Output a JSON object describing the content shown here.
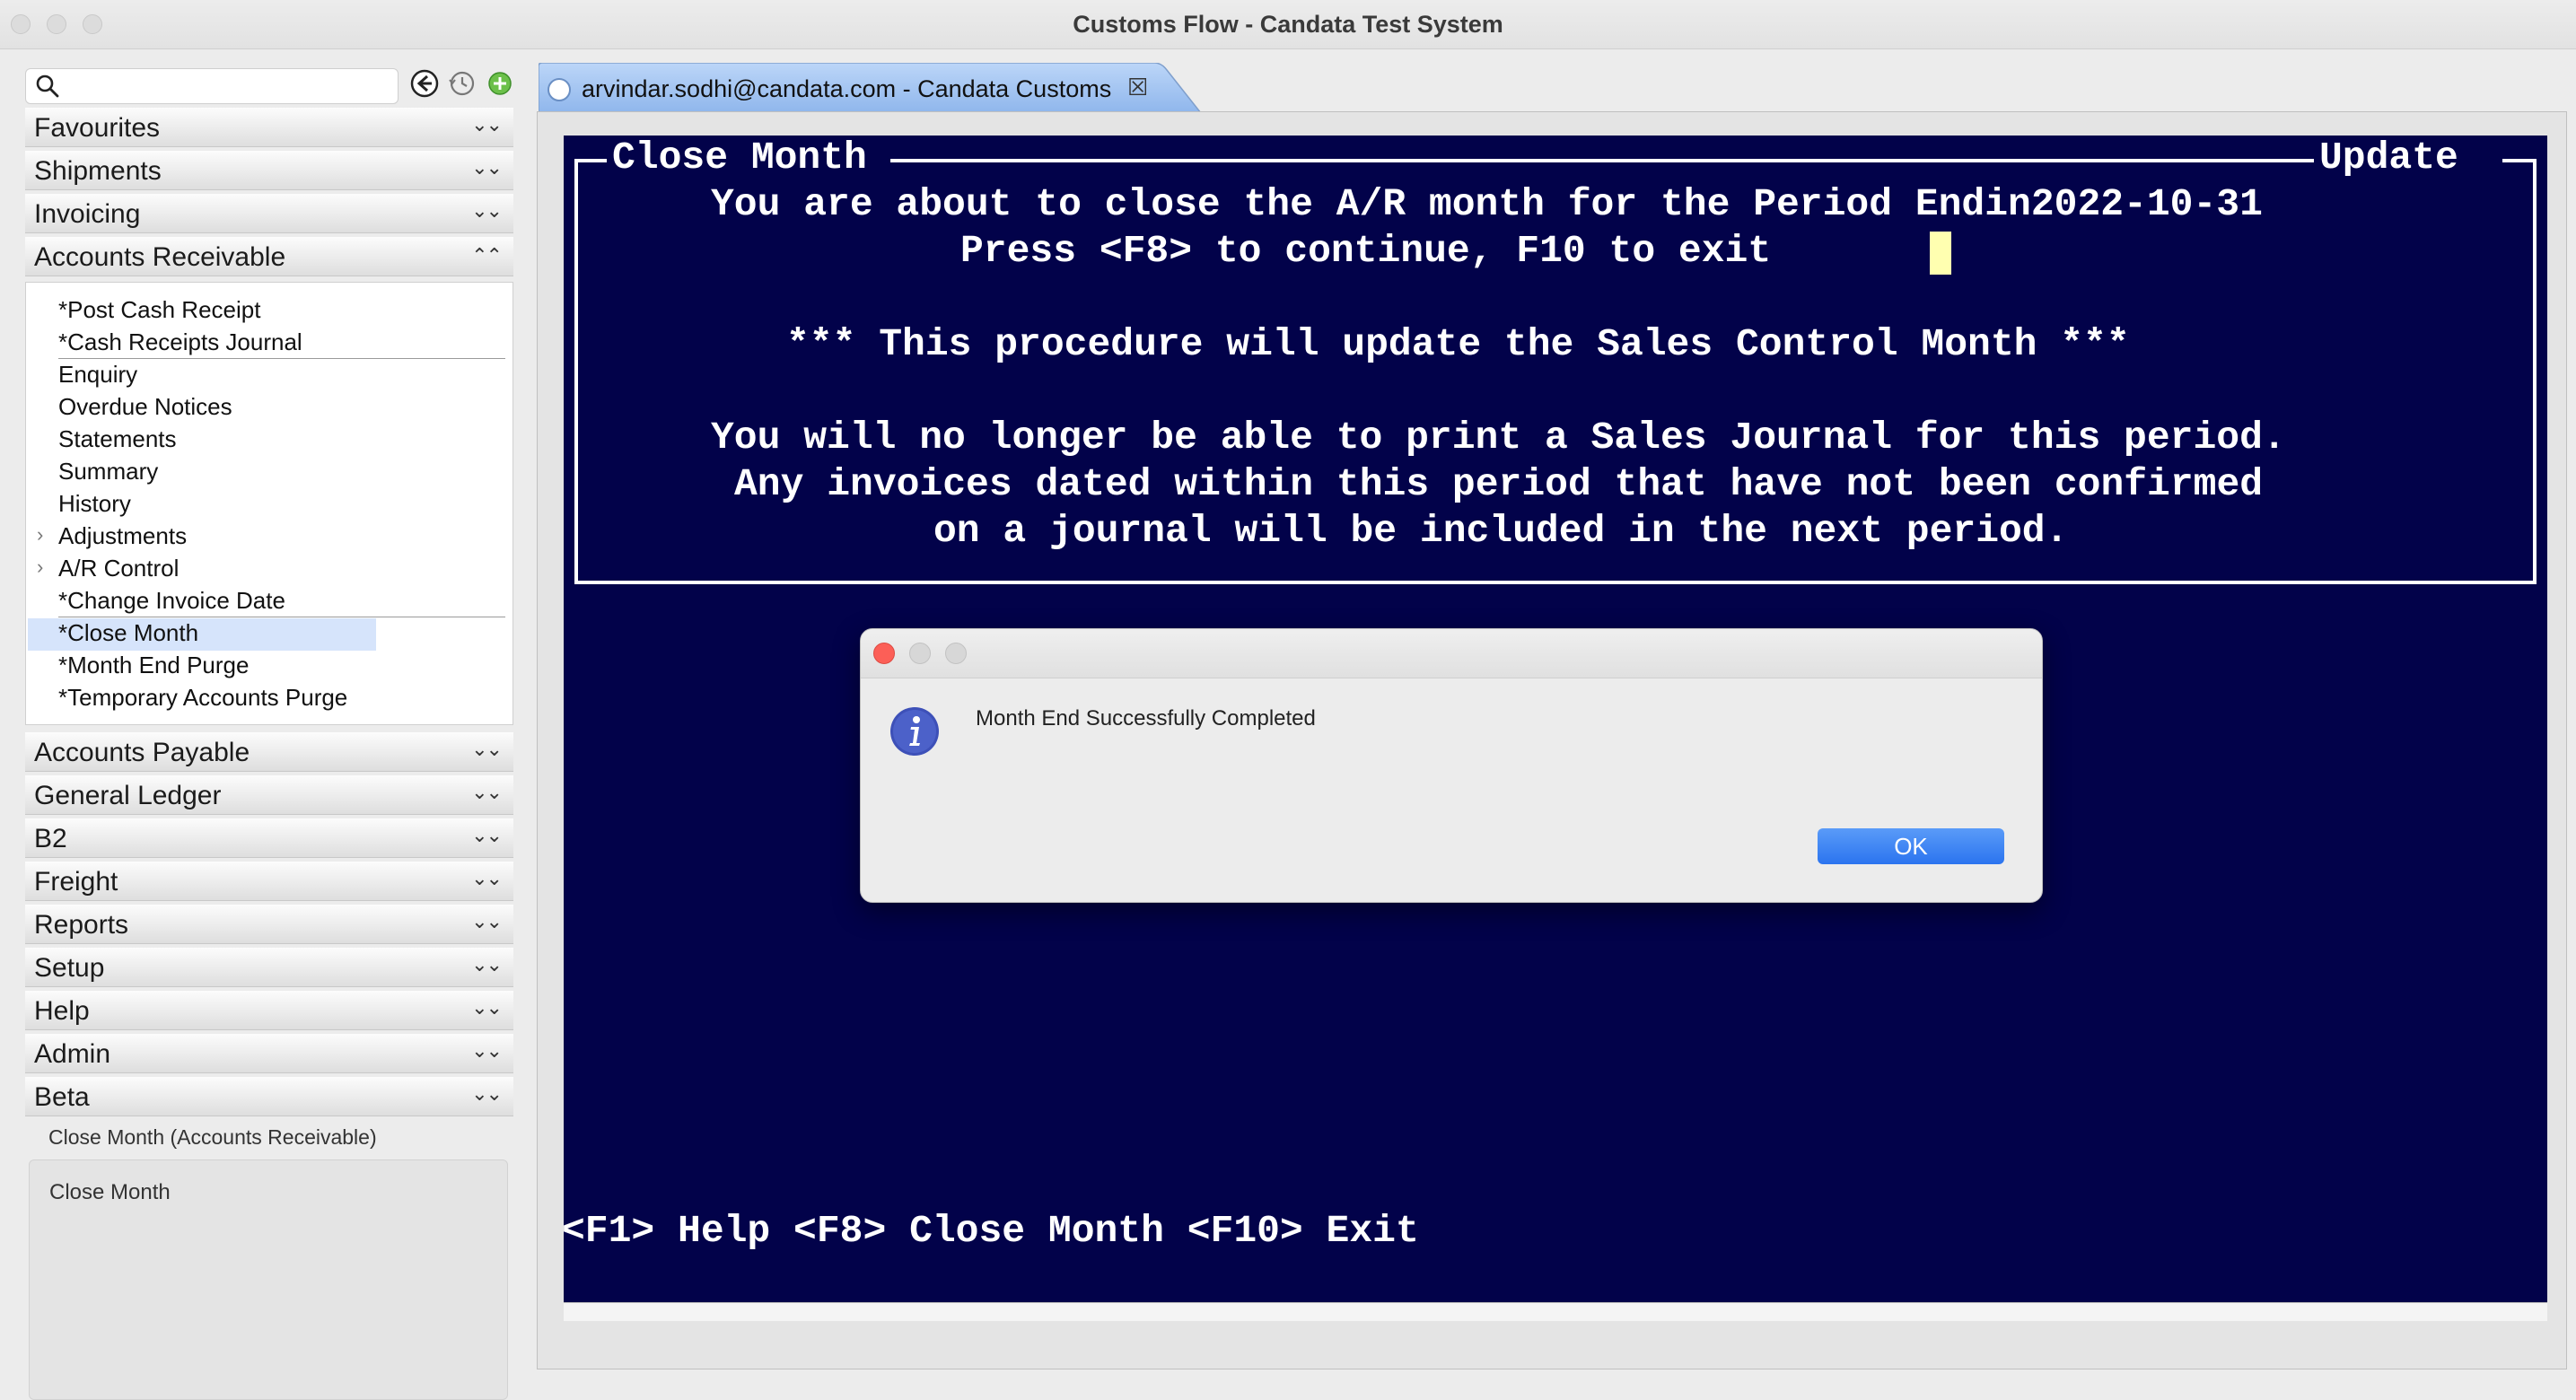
{
  "window": {
    "title": "Customs Flow - Candata Test System"
  },
  "sidebar": {
    "search": {
      "placeholder": "",
      "value": ""
    },
    "sections_top": [
      {
        "label": "Favourites"
      },
      {
        "label": "Shipments"
      },
      {
        "label": "Invoicing"
      },
      {
        "label": "Accounts Receivable",
        "expanded": true
      }
    ],
    "ar_items": [
      {
        "label": "*Post Cash Receipt"
      },
      {
        "label": "*Cash Receipts Journal"
      },
      {
        "label": "Enquiry"
      },
      {
        "label": "Overdue Notices"
      },
      {
        "label": "Statements"
      },
      {
        "label": "Summary"
      },
      {
        "label": "History"
      },
      {
        "label": "Adjustments",
        "has_children": true
      },
      {
        "label": "A/R Control",
        "has_children": true
      },
      {
        "label": "*Change Invoice Date"
      },
      {
        "label": "*Close Month",
        "selected": true
      },
      {
        "label": "*Month End Purge"
      },
      {
        "label": "*Temporary Accounts Purge"
      }
    ],
    "sections_bottom": [
      {
        "label": "Accounts Payable"
      },
      {
        "label": "General Ledger"
      },
      {
        "label": "B2"
      },
      {
        "label": "Freight"
      },
      {
        "label": "Reports"
      },
      {
        "label": "Setup"
      },
      {
        "label": "Help"
      },
      {
        "label": "Admin"
      },
      {
        "label": "Beta"
      }
    ],
    "description": {
      "title": "Close Month (Accounts Receivable)",
      "text": "Close Month"
    }
  },
  "tab": {
    "label": "arvindar.sodhi@candata.com - Candata Customs"
  },
  "terminal": {
    "frame_title_left": "Close Month",
    "frame_title_right": "Update",
    "lines": [
      "You are about to close the A/R month for the Period Endin2022-10-31",
      "Press <F8> to continue, F10 to exit",
      "*** This procedure will update the Sales Control Month ***",
      "You will no longer be able to print a Sales Journal for this period.",
      "Any invoices dated within this period that have not been confirmed",
      "on a journal will be included in the next period."
    ],
    "footer": "<F1> Help <F8> Close Month <F10> Exit"
  },
  "dialog": {
    "message": "Month End Successfully Completed",
    "ok_label": "OK"
  },
  "colors": {
    "terminal_bg": "#02024a",
    "terminal_text": "#ffffff",
    "cursor": "#ffffb0",
    "ok_button": "#2b74ef",
    "selection": "#d6e4fb"
  }
}
